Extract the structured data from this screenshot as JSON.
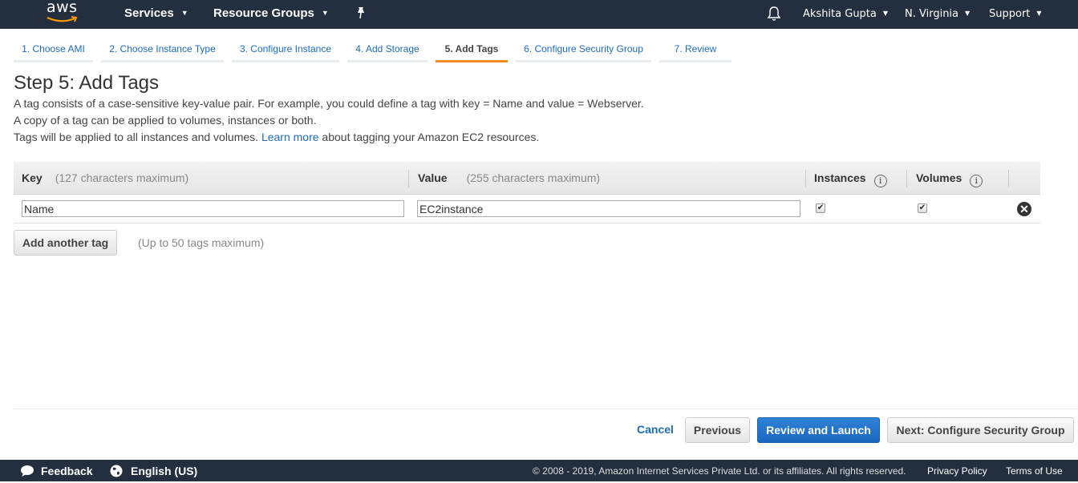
{
  "topnav": {
    "logo_text": "aws",
    "services_label": "Services",
    "resource_groups_label": "Resource Groups",
    "user_label": "Akshita Gupta",
    "region_label": "N. Virginia",
    "support_label": "Support"
  },
  "steps": [
    {
      "label": "1. Choose AMI",
      "active": false
    },
    {
      "label": "2. Choose Instance Type",
      "active": false
    },
    {
      "label": "3. Configure Instance",
      "active": false
    },
    {
      "label": "4. Add Storage",
      "active": false
    },
    {
      "label": "5. Add Tags",
      "active": true
    },
    {
      "label": "6. Configure Security Group",
      "active": false
    },
    {
      "label": "7. Review",
      "active": false
    }
  ],
  "page": {
    "title": "Step 5: Add Tags",
    "desc_line1": "A tag consists of a case-sensitive key-value pair. For example, you could define a tag with key = Name and value = Webserver.",
    "desc_line2": "A copy of a tag can be applied to volumes, instances or both.",
    "desc_line3_before": "Tags will be applied to all instances and volumes. ",
    "desc_line3_link": "Learn more",
    "desc_line3_after": " about tagging your Amazon EC2 resources."
  },
  "table": {
    "headers": {
      "key": "Key",
      "key_hint": "(127 characters maximum)",
      "value": "Value",
      "value_hint": "(255 characters maximum)",
      "instances": "Instances",
      "volumes": "Volumes"
    },
    "rows": [
      {
        "key": "Name",
        "value": "EC2instance",
        "instances": true,
        "volumes": true
      }
    ]
  },
  "add_tag": {
    "button_label": "Add another tag",
    "hint": "(Up to 50 tags maximum)"
  },
  "actions": {
    "cancel": "Cancel",
    "previous": "Previous",
    "review_launch": "Review and Launch",
    "next": "Next: Configure Security Group"
  },
  "bottombar": {
    "feedback": "Feedback",
    "language": "English (US)",
    "copyright": "© 2008 - 2019, Amazon Internet Services Private Ltd. or its affiliates. All rights reserved.",
    "privacy": "Privacy Policy",
    "terms": "Terms of Use"
  },
  "colors": {
    "nav_bg": "#232f3e",
    "accent_orange": "#f38b21",
    "link_blue": "#1a6bc6",
    "primary_button": "#1b66bf"
  }
}
